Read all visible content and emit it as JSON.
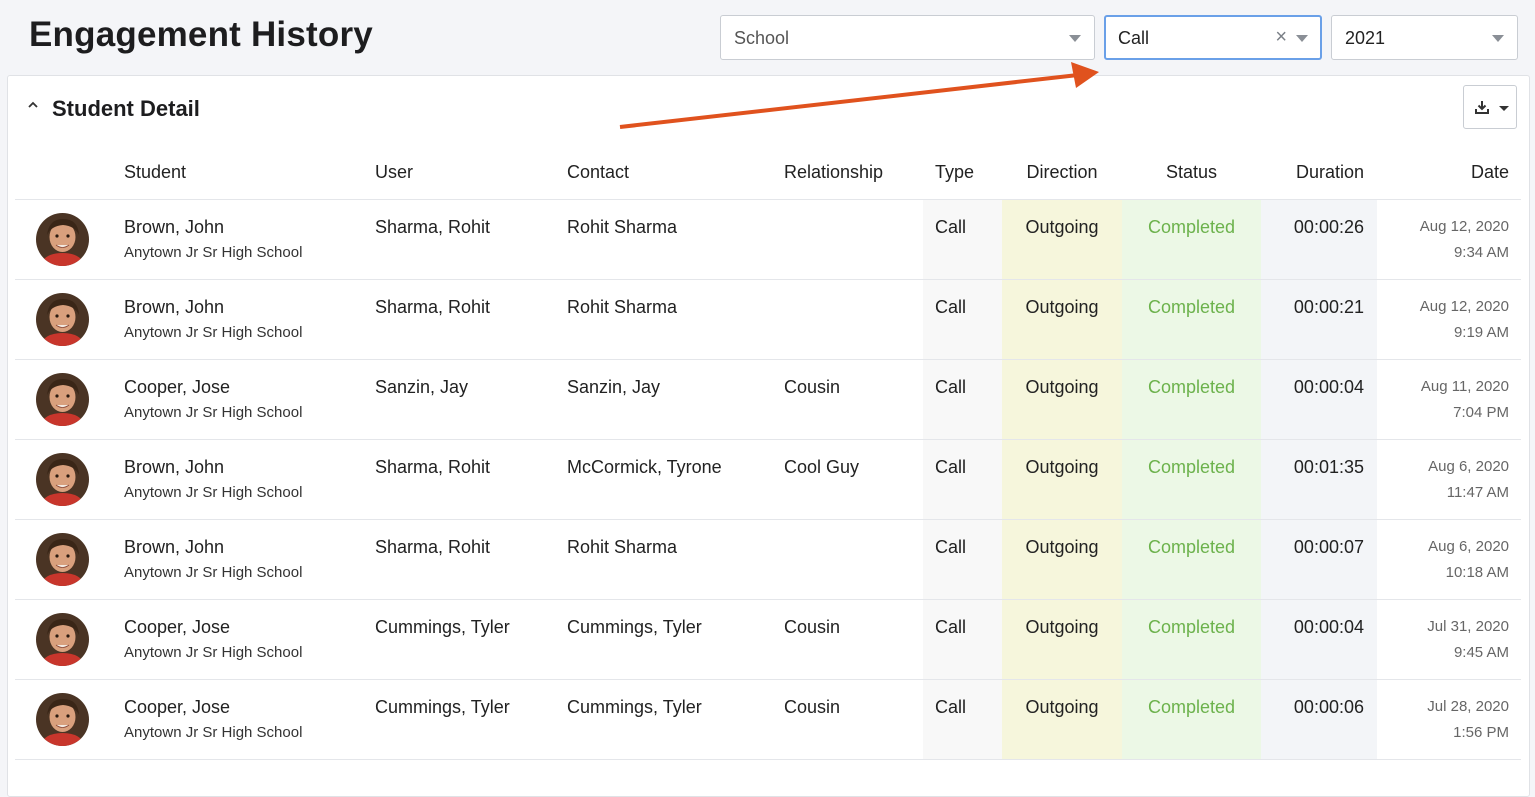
{
  "header": {
    "title": "Engagement History"
  },
  "filters": {
    "school": {
      "value": "School"
    },
    "type": {
      "value": "Call",
      "clear": "×"
    },
    "year": {
      "value": "2021"
    }
  },
  "card": {
    "title": "Student Detail"
  },
  "columns": {
    "student": "Student",
    "user": "User",
    "contact": "Contact",
    "relationship": "Relationship",
    "type": "Type",
    "direction": "Direction",
    "status": "Status",
    "duration": "Duration",
    "date": "Date"
  },
  "rows": [
    {
      "student": "Brown, John",
      "school": "Anytown Jr Sr High School",
      "user": "Sharma, Rohit",
      "contact": "Rohit Sharma",
      "relationship": "",
      "type": "Call",
      "direction": "Outgoing",
      "status": "Completed",
      "duration": "00:00:26",
      "date": "Aug 12, 2020",
      "time": "9:34 AM"
    },
    {
      "student": "Brown, John",
      "school": "Anytown Jr Sr High School",
      "user": "Sharma, Rohit",
      "contact": "Rohit Sharma",
      "relationship": "",
      "type": "Call",
      "direction": "Outgoing",
      "status": "Completed",
      "duration": "00:00:21",
      "date": "Aug 12, 2020",
      "time": "9:19 AM"
    },
    {
      "student": "Cooper, Jose",
      "school": "Anytown Jr Sr High School",
      "user": "Sanzin, Jay",
      "contact": "Sanzin, Jay",
      "relationship": "Cousin",
      "type": "Call",
      "direction": "Outgoing",
      "status": "Completed",
      "duration": "00:00:04",
      "date": "Aug 11, 2020",
      "time": "7:04 PM"
    },
    {
      "student": "Brown, John",
      "school": "Anytown Jr Sr High School",
      "user": "Sharma, Rohit",
      "contact": "McCormick, Tyrone",
      "relationship": "Cool Guy",
      "type": "Call",
      "direction": "Outgoing",
      "status": "Completed",
      "duration": "00:01:35",
      "date": "Aug 6, 2020",
      "time": "11:47 AM"
    },
    {
      "student": "Brown, John",
      "school": "Anytown Jr Sr High School",
      "user": "Sharma, Rohit",
      "contact": "Rohit Sharma",
      "relationship": "",
      "type": "Call",
      "direction": "Outgoing",
      "status": "Completed",
      "duration": "00:00:07",
      "date": "Aug 6, 2020",
      "time": "10:18 AM"
    },
    {
      "student": "Cooper, Jose",
      "school": "Anytown Jr Sr High School",
      "user": "Cummings, Tyler",
      "contact": "Cummings, Tyler",
      "relationship": "Cousin",
      "type": "Call",
      "direction": "Outgoing",
      "status": "Completed",
      "duration": "00:00:04",
      "date": "Jul 31, 2020",
      "time": "9:45 AM"
    },
    {
      "student": "Cooper, Jose",
      "school": "Anytown Jr Sr High School",
      "user": "Cummings, Tyler",
      "contact": "Cummings, Tyler",
      "relationship": "Cousin",
      "type": "Call",
      "direction": "Outgoing",
      "status": "Completed",
      "duration": "00:00:06",
      "date": "Jul 28, 2020",
      "time": "1:56 PM"
    }
  ],
  "colors": {
    "status_text": "#6cb24c",
    "annotation_arrow": "#e0521e",
    "focus_border": "#6aa0e8"
  },
  "icons": {
    "collapse": "chevron-up-icon",
    "export": "download-icon",
    "avatar": "student-avatar"
  }
}
